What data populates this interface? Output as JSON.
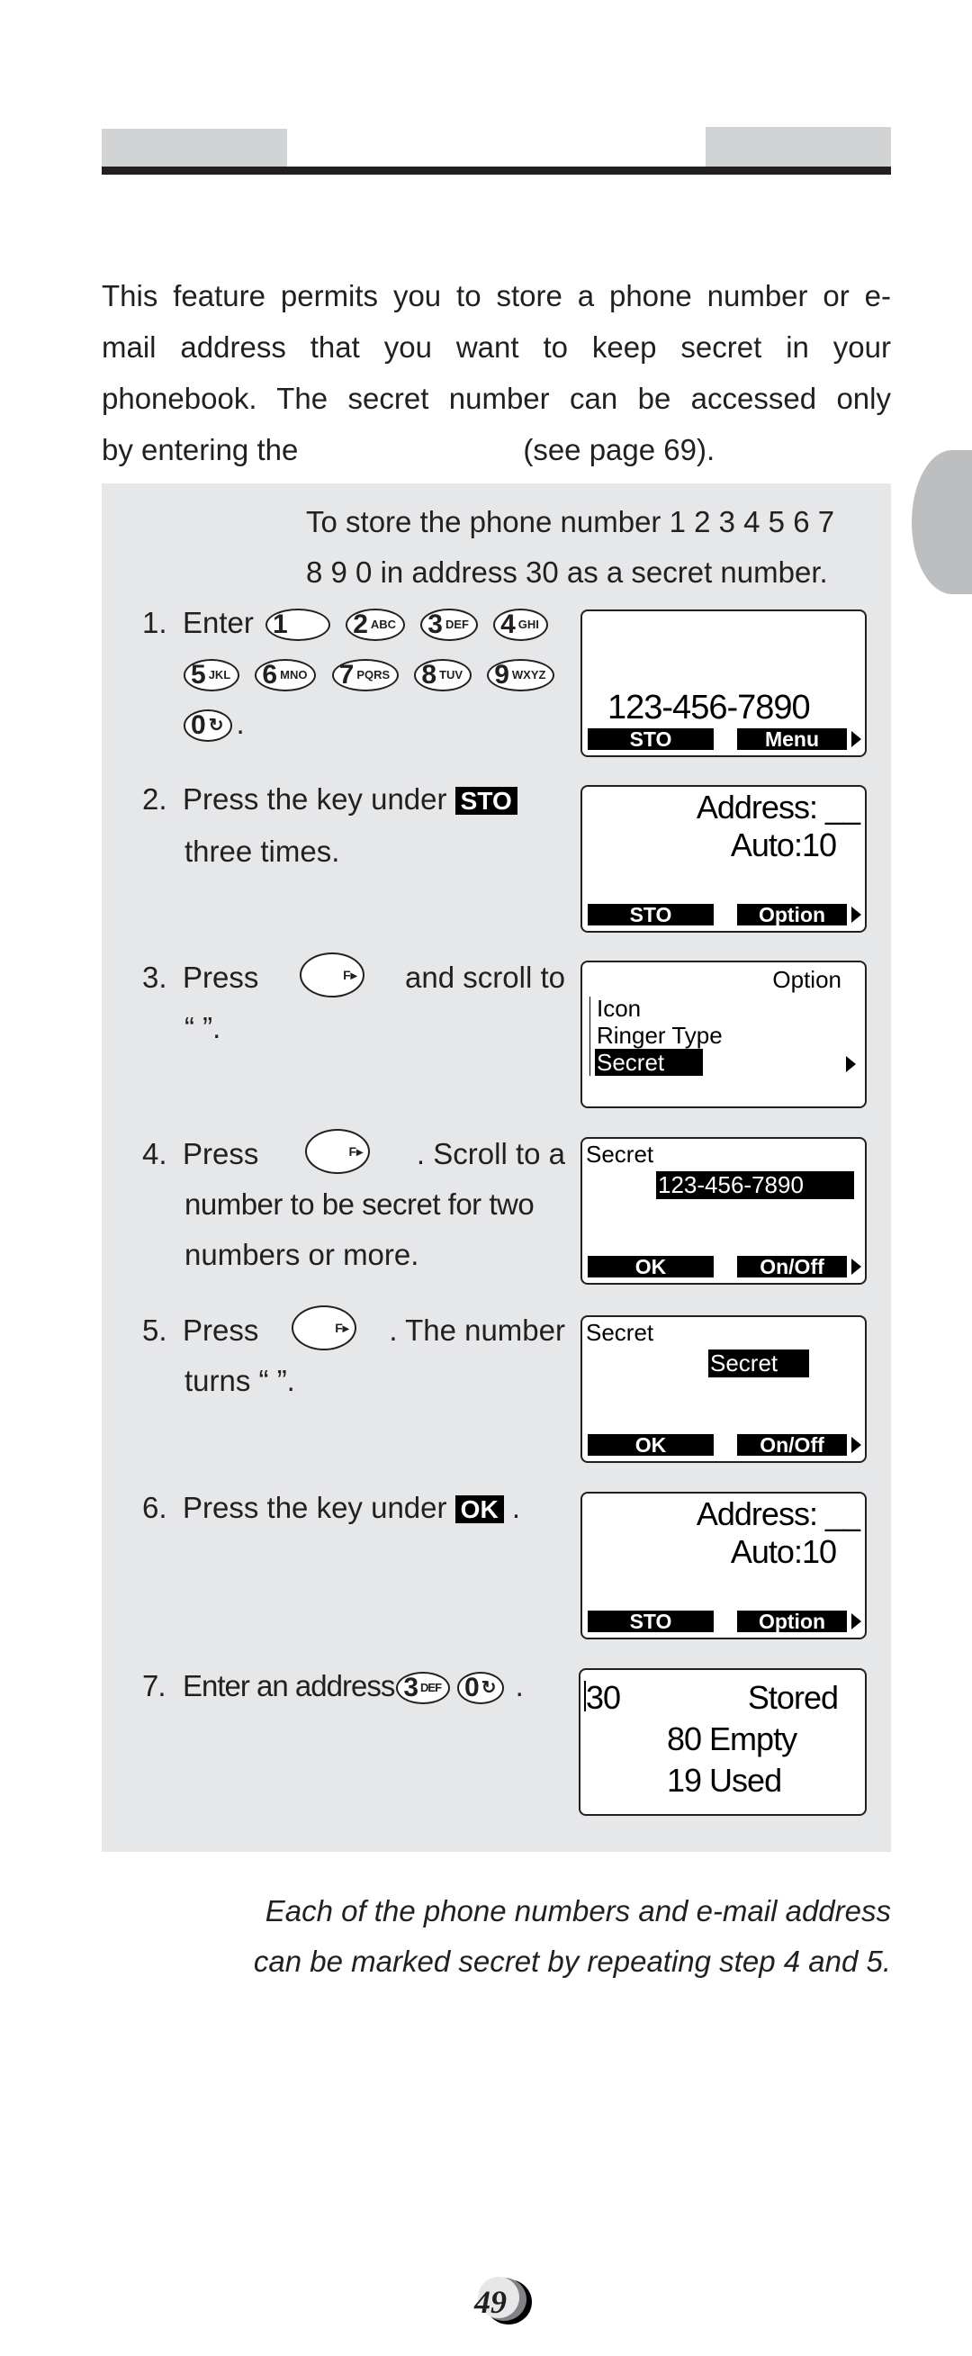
{
  "intro": {
    "line1": "This feature permits you to store a phone number or e-",
    "line2": "mail address that you want to keep secret in your",
    "line3": "phonebook. The secret number can be accessed only",
    "line4_before": "by entering the",
    "line4_after": "(see  page 69)."
  },
  "goal": {
    "line1": "To store the phone number 1 2 3 4 5 6 7",
    "line2": "8 9 0 in address 30 as a secret number."
  },
  "keys": {
    "k1": {
      "digit": "1",
      "letters": ""
    },
    "k2": {
      "digit": "2",
      "letters": "ABC"
    },
    "k3": {
      "digit": "3",
      "letters": "DEF"
    },
    "k4": {
      "digit": "4",
      "letters": "GHI"
    },
    "k5": {
      "digit": "5",
      "letters": "JKL"
    },
    "k6": {
      "digit": "6",
      "letters": "MNO"
    },
    "k7": {
      "digit": "7",
      "letters": "PQRS"
    },
    "k8": {
      "digit": "8",
      "letters": "TUV"
    },
    "k9": {
      "digit": "9",
      "letters": "WXYZ"
    },
    "k0": {
      "digit": "0",
      "letters": "↻"
    },
    "fkey": "F▸"
  },
  "steps": [
    {
      "num": "1.",
      "text": "Enter",
      "end": "."
    },
    {
      "num": "2.",
      "text": "Press the key under",
      "badge": "STO",
      "line2": "three times."
    },
    {
      "num": "3.",
      "w1": "Press",
      "w2": "and scroll to",
      "line2": "“            ”."
    },
    {
      "num": "4.",
      "w1": "Press",
      "w2": ". Scroll to a",
      "line2": "number to be secret for two",
      "line3": "numbers or more."
    },
    {
      "num": "5.",
      "w1": "Press",
      "w2": ". The number",
      "line2": "turns “            ”."
    },
    {
      "num": "6.",
      "text": "Press the key under",
      "badge": "OK",
      "end": "."
    },
    {
      "num": "7.",
      "text": "Enter an address",
      "end": "."
    }
  ],
  "screens": [
    {
      "number": "123-456-7890",
      "soft_left": "STO",
      "soft_right": "Menu"
    },
    {
      "line1": "Address:  __",
      "line2": "Auto:10",
      "soft_left": "STO",
      "soft_right": "Option"
    },
    {
      "title": "Option",
      "items": [
        "Icon",
        "Ringer Type",
        "Secret"
      ],
      "selected": "Secret"
    },
    {
      "title": "Secret",
      "value": "123-456-7890",
      "soft_left": "OK",
      "soft_right": "On/Off"
    },
    {
      "title": "Secret",
      "value": "Secret",
      "soft_left": "OK",
      "soft_right": "On/Off"
    },
    {
      "line1": "Address:  __",
      "line2": "Auto:10",
      "soft_left": "STO",
      "soft_right": "Option"
    },
    {
      "address": "30",
      "status": "Stored",
      "line2": "80 Empty",
      "line3": "19 Used"
    }
  ],
  "note": {
    "line1": "Each of the phone numbers and e-mail address",
    "line2": "can be marked secret by repeating step 4 and 5."
  },
  "page_number": "49"
}
